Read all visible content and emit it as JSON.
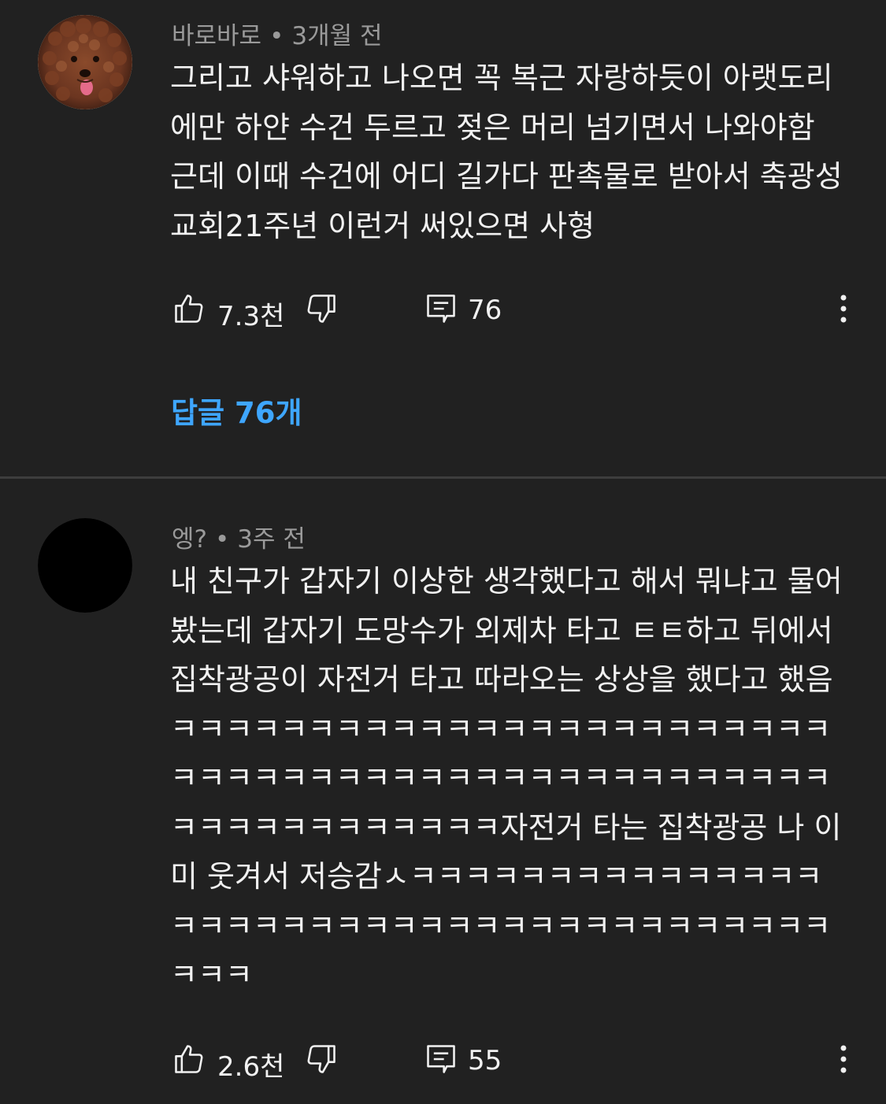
{
  "comments": [
    {
      "author": "바로바로",
      "time": "3개월 전",
      "separator": "•",
      "text": "그리고 샤워하고 나오면 꼭 복근 자랑하듯이 아랫도리에만 하얀 수건 두르고 젖은 머리 넘기면서 나와야함 근데 이때 수건에 어디 길가다 판촉물로 받아서 축광성교회21주년 이런거 써있으면 사형",
      "likes": "7.3천",
      "reply_count": "76",
      "replies_link": "답글 76개",
      "avatar_icon": "poodle-avatar-icon"
    },
    {
      "author": "엥?",
      "time": "3주 전",
      "separator": "•",
      "text": "내 친구가 갑자기 이상한 생각했다고 해서 뭐냐고 물어봤는데 갑자기 도망수가 외제차 타고 ㅌㅌ하고 뒤에서 집착광공이 자전거 타고 따라오는 상상을 했다고 했음 ㅋㅋㅋㅋㅋㅋㅋㅋㅋㅋㅋㅋㅋㅋㅋㅋㅋㅋㅋㅋㅋㅋㅋㅋㅋㅋㅋㅋㅋㅋㅋㅋㅋㅋㅋㅋㅋㅋㅋㅋㅋㅋㅋㅋㅋㅋㅋㅋㅋㅋㅋㅋㅋㅋㅋㅋㅋㅋㅋㅋ자전거 타는 집착광공 나 이미 웃겨서 저승감ㅅㅋㅋㅋㅋㅋㅋㅋㅋㅋㅋㅋㅋㅋㅋㅋㅋㅋㅋㅋㅋㅋㅋㅋㅋㅋㅋㅋㅋㅋㅋㅋㅋㅋㅋㅋㅋㅋㅋㅋㅋㅋㅋ",
      "likes": "2.6천",
      "reply_count": "55",
      "avatar_icon": "black-avatar-icon"
    }
  ],
  "colors": {
    "background": "#212121",
    "text": "#f1f1f1",
    "meta": "#9a9a9a",
    "link": "#3ea6ff",
    "divider": "#3d3d3d"
  },
  "icons": {
    "like": "thumbs-up-icon",
    "dislike": "thumbs-down-icon",
    "reply": "comment-icon",
    "more": "more-vertical-icon"
  }
}
